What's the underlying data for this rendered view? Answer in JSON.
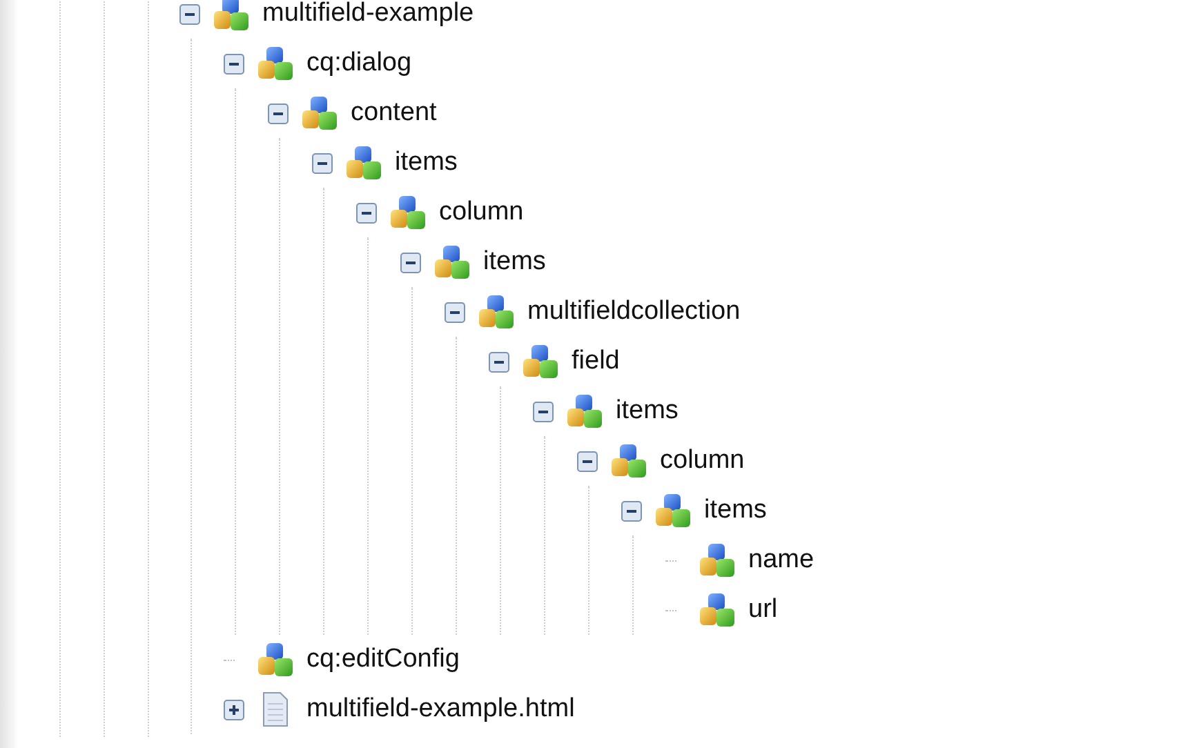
{
  "tree": [
    {
      "label": "multifield-example",
      "kind": "node",
      "expanded": true,
      "children": [
        {
          "label": "cq:dialog",
          "kind": "node",
          "expanded": true,
          "children": [
            {
              "label": "content",
              "kind": "node",
              "expanded": true,
              "children": [
                {
                  "label": "items",
                  "kind": "node",
                  "expanded": true,
                  "children": [
                    {
                      "label": "column",
                      "kind": "node",
                      "expanded": true,
                      "children": [
                        {
                          "label": "items",
                          "kind": "node",
                          "expanded": true,
                          "children": [
                            {
                              "label": "multifieldcollection",
                              "kind": "node",
                              "expanded": true,
                              "children": [
                                {
                                  "label": "field",
                                  "kind": "node",
                                  "expanded": true,
                                  "children": [
                                    {
                                      "label": "items",
                                      "kind": "node",
                                      "expanded": true,
                                      "children": [
                                        {
                                          "label": "column",
                                          "kind": "node",
                                          "expanded": true,
                                          "children": [
                                            {
                                              "label": "items",
                                              "kind": "node",
                                              "expanded": true,
                                              "children": [
                                                {
                                                  "label": "name",
                                                  "kind": "node"
                                                },
                                                {
                                                  "label": "url",
                                                  "kind": "node"
                                                }
                                              ]
                                            }
                                          ]
                                        }
                                      ]
                                    }
                                  ]
                                }
                              ]
                            }
                          ]
                        }
                      ]
                    }
                  ]
                }
              ]
            }
          ]
        },
        {
          "label": "cq:editConfig",
          "kind": "node"
        },
        {
          "label": "multifield-example.html",
          "kind": "file",
          "expanded": false
        }
      ]
    }
  ]
}
